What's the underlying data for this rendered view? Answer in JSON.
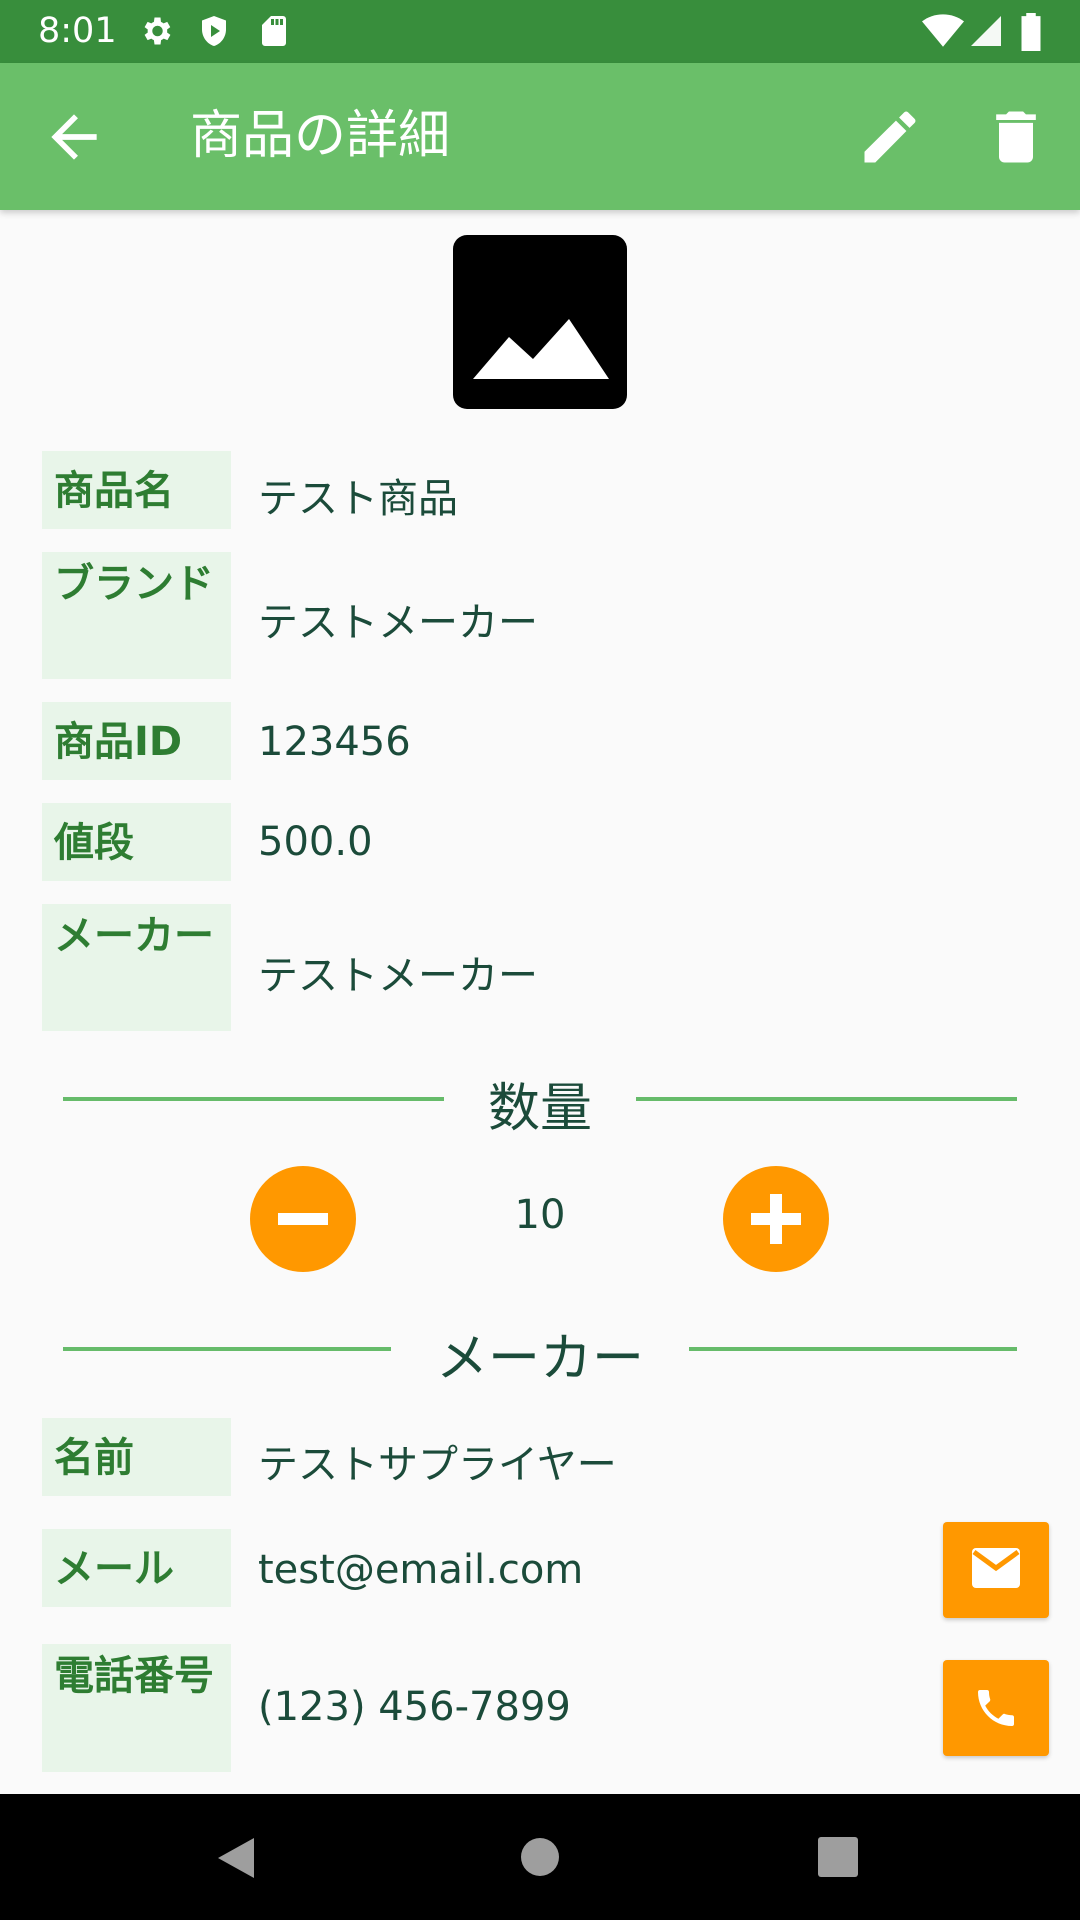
{
  "status_bar": {
    "time": "8:01"
  },
  "app_bar": {
    "title": "商品の詳細"
  },
  "product": {
    "rows": [
      {
        "label": "商品名",
        "value": "テスト商品"
      },
      {
        "label": "ブランド",
        "value": "テストメーカー"
      },
      {
        "label": "商品ID",
        "value": "123456"
      },
      {
        "label": "値段",
        "value": "500.0"
      },
      {
        "label": "メーカー",
        "value": "テストメーカー"
      }
    ]
  },
  "quantity": {
    "title": "数量",
    "value": "10"
  },
  "maker": {
    "title": "メーカー",
    "rows": [
      {
        "label": "名前",
        "value": "テストサプライヤー"
      },
      {
        "label": "メール",
        "value": "test@email.com"
      },
      {
        "label": "電話番号",
        "value": "(123) 456-7899"
      }
    ]
  },
  "icons": {
    "back": "arrow-back-icon",
    "edit": "pencil-icon",
    "delete": "trash-icon",
    "photo": "image-placeholder-icon",
    "minus": "minus-icon",
    "plus": "plus-icon",
    "mail": "mail-icon",
    "phone": "phone-icon"
  },
  "colors": {
    "status_bar": "#388e3c",
    "app_bar": "#6abf69",
    "accent": "#ff9800",
    "label_bg": "#e8f5e9",
    "label_text": "#2e7d32"
  }
}
